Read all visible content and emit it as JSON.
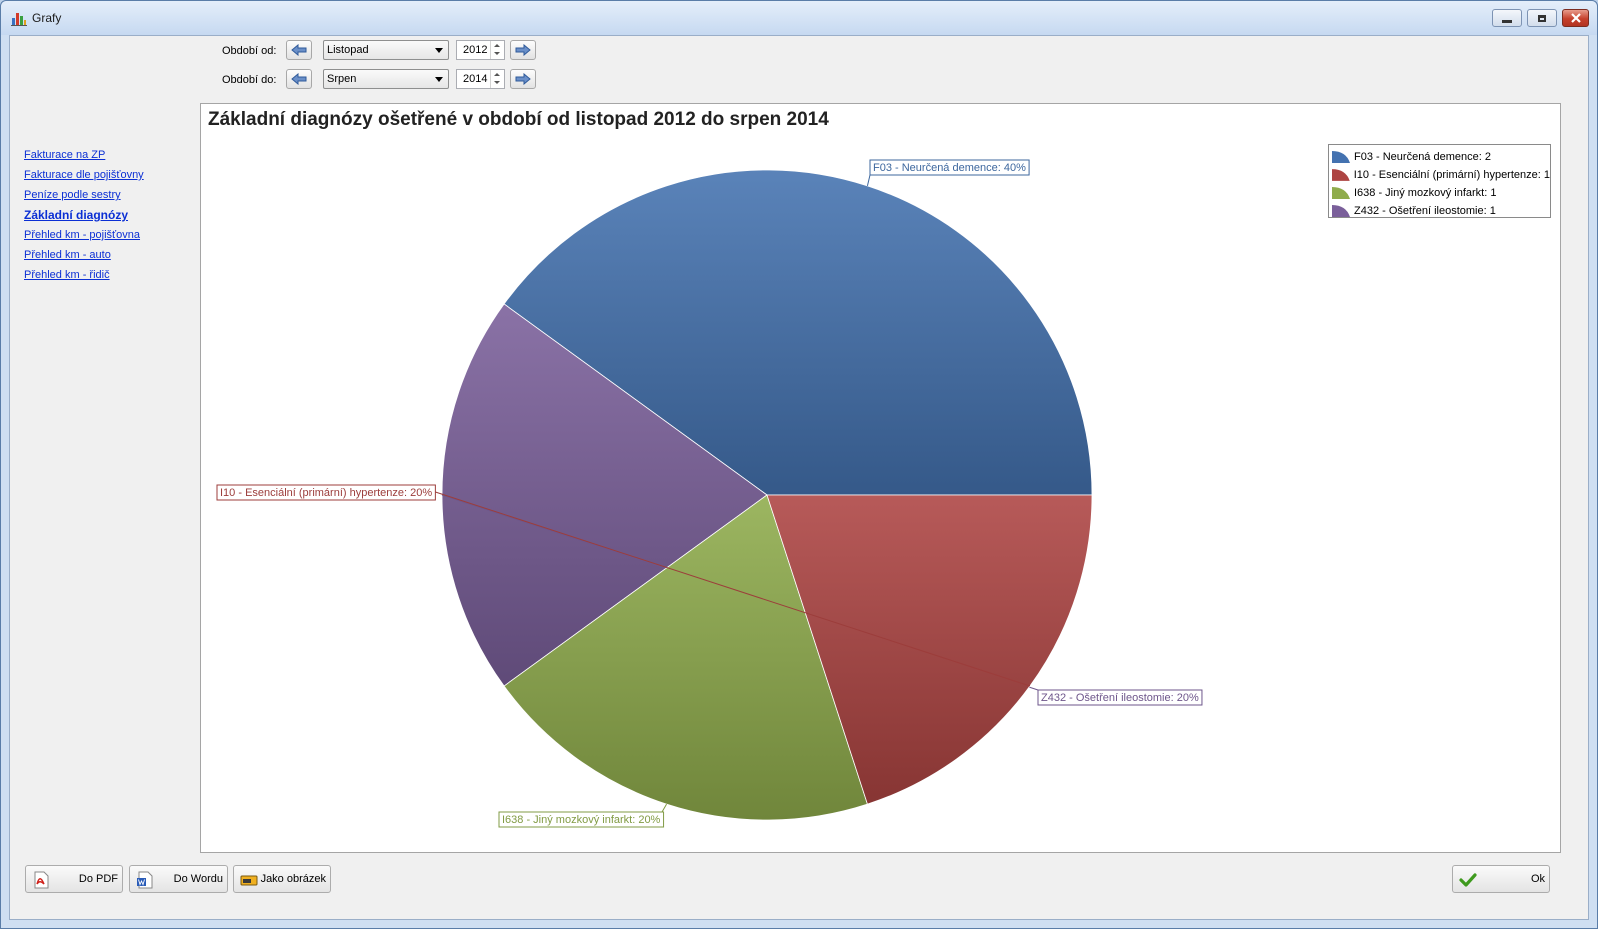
{
  "window": {
    "title": "Grafy"
  },
  "period": {
    "from_label": "Období od:",
    "from_month": "Listopad",
    "from_year": "2012",
    "to_label": "Období do:",
    "to_month": "Srpen",
    "to_year": "2014"
  },
  "sidebar": {
    "items": [
      {
        "label": "Fakturace na ZP"
      },
      {
        "label": "Fakturace dle pojišťovny"
      },
      {
        "label": "Peníze podle sestry"
      },
      {
        "label": "Základní diagnózy"
      },
      {
        "label": "Přehled km - pojišťovna"
      },
      {
        "label": "Přehled km - auto"
      },
      {
        "label": "Přehled km - řidič"
      }
    ],
    "active_index": 3
  },
  "buttons": {
    "pdf": "Do PDF",
    "word": "Do Wordu",
    "image": "Jako obrázek",
    "ok": "Ok"
  },
  "icons": {
    "app": "bar-chart-icon",
    "prev": "arrow-left-icon",
    "next": "arrow-right-icon",
    "pdf": "pdf-icon",
    "word": "word-icon",
    "image": "image-icon",
    "ok": "checkmark-icon"
  },
  "chart_data": {
    "type": "pie",
    "title": "Základní diagnózy ošetřené v období od listopad 2012 do srpen 2014",
    "slices": [
      {
        "name": "F03 - Neurčená demence",
        "value": 2,
        "percent": 40,
        "color": "#4472b0",
        "legend": "F03 - Neurčená demence: 2",
        "label": "F03 - Neurčená demence: 40%"
      },
      {
        "name": "Z432 - Ošetření ileostomie",
        "value": 1,
        "percent": 20,
        "color": "#7a5f9a",
        "legend": "Z432 - Ošetření ileostomie: 1",
        "label": "Z432 - Ošetření ileostomie: 20%"
      },
      {
        "name": "I638 - Jiný mozkový infarkt",
        "value": 1,
        "percent": 20,
        "color": "#8fac4c",
        "legend": "I638 - Jiný mozkový infarkt: 1",
        "label": "I638 - Jiný mozkový infarkt: 20%"
      },
      {
        "name": "I10 - Esenciální (primární) hypertenze",
        "value": 1,
        "percent": 20,
        "color": "#ad4442",
        "legend": "I10 - Esenciální (primární) hypertenze: 1",
        "label": "I10 - Esenciální (primární) hypertenze: 20%"
      }
    ],
    "legend_order": [
      0,
      3,
      2,
      1
    ],
    "legend_position": "top-right"
  }
}
